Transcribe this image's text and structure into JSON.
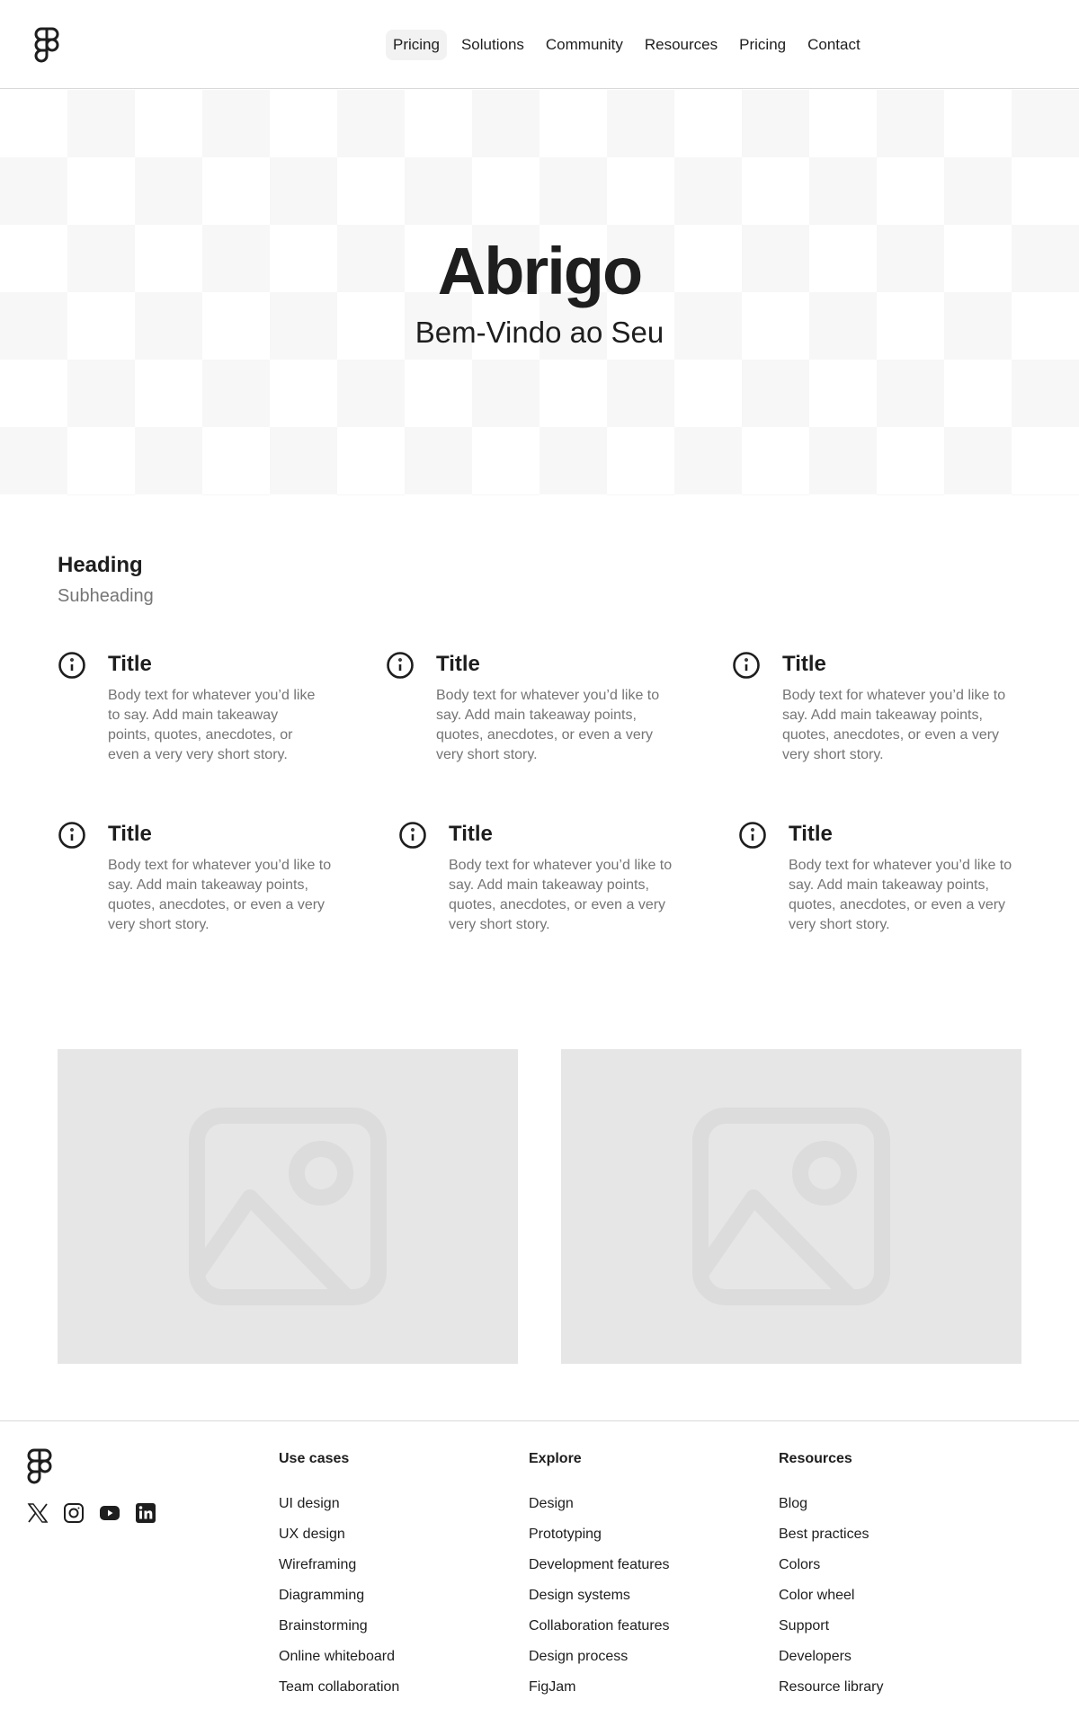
{
  "header": {
    "nav": [
      {
        "label": "Pricing",
        "active": true
      },
      {
        "label": "Solutions"
      },
      {
        "label": "Community"
      },
      {
        "label": "Resources"
      },
      {
        "label": "Pricing"
      },
      {
        "label": "Contact"
      }
    ]
  },
  "hero": {
    "title": "Abrigo",
    "subtitle": "Bem-Vindo ao Seu"
  },
  "features": {
    "heading": "Heading",
    "subheading": "Subheading",
    "cards": [
      {
        "title": "Title",
        "body": "Body text for whatever you’d like to say. Add main takeaway points, quotes, anecdotes, or even a very very short story."
      },
      {
        "title": "Title",
        "body": "Body text for whatever you’d like to say. Add main takeaway points, quotes, anecdotes, or even a very very short story."
      },
      {
        "title": "Title",
        "body": "Body text for whatever you’d like to say. Add main takeaway points, quotes, anecdotes, or even a very very short story."
      },
      {
        "title": "Title",
        "body": "Body text for whatever you’d like to say. Add main takeaway points, quotes, anecdotes, or even a very very short story."
      },
      {
        "title": "Title",
        "body": "Body text for whatever you’d like to say. Add main takeaway points, quotes, anecdotes, or even a very very short story."
      },
      {
        "title": "Title",
        "body": "Body text for whatever you’d like to say. Add main takeaway points, quotes, anecdotes, or even a very very short story."
      }
    ]
  },
  "footer": {
    "social": [
      "x-icon",
      "instagram-icon",
      "youtube-icon",
      "linkedin-icon"
    ],
    "columns": [
      {
        "heading": "Use cases",
        "links": [
          "UI design",
          "UX design",
          "Wireframing",
          "Diagramming",
          "Brainstorming",
          "Online whiteboard",
          "Team collaboration"
        ]
      },
      {
        "heading": "Explore",
        "links": [
          "Design",
          "Prototyping",
          "Development features",
          "Design systems",
          "Collaboration features",
          "Design process",
          "FigJam"
        ]
      },
      {
        "heading": "Resources",
        "links": [
          "Blog",
          "Best practices",
          "Colors",
          "Color wheel",
          "Support",
          "Developers",
          "Resource library"
        ]
      }
    ]
  },
  "colors": {
    "text": "#1e1e1e",
    "muted": "#757575",
    "placeholder": "#e6e6e6",
    "border": "#d9d9d9"
  }
}
